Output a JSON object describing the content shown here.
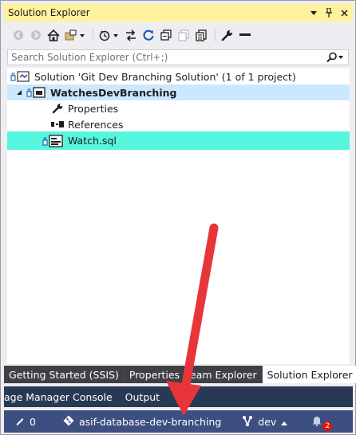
{
  "panel": {
    "title": "Solution Explorer",
    "titlebar_icons": [
      "dropdown-icon",
      "pin-icon",
      "close-icon"
    ]
  },
  "search": {
    "placeholder": "Search Solution Explorer (Ctrl+;)"
  },
  "tree": {
    "solution": "Solution 'Git Dev Branching Solution' (1 of 1 project)",
    "project": "WatchesDevBranching",
    "properties": "Properties",
    "references": "References",
    "file": "Watch.sql"
  },
  "tool_tabs": [
    {
      "label": "Getting Started (SSIS)"
    },
    {
      "label": "Properties"
    },
    {
      "label": "eam Explorer"
    },
    {
      "label": "Solution Explorer"
    }
  ],
  "window_tabs": [
    {
      "label": "age Manager Console"
    },
    {
      "label": "Output"
    }
  ],
  "status": {
    "pending_changes": "0",
    "repository": "asif-database-dev-branching",
    "branch": "dev",
    "notifications": "2"
  },
  "colors": {
    "titlebar": "#fff29d",
    "selected_item": "#55f6dd",
    "project_row": "#cce8ff",
    "status_bar": "#3d4f80",
    "annotation_arrow": "#e8353a"
  }
}
